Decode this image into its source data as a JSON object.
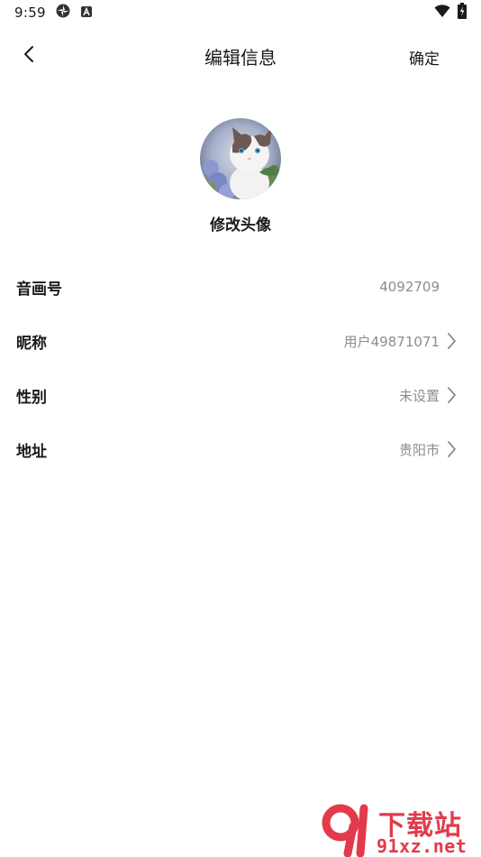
{
  "status_bar": {
    "time": "9:59"
  },
  "header": {
    "title": "编辑信息",
    "confirm_label": "确定"
  },
  "avatar": {
    "change_label": "修改头像"
  },
  "rows": [
    {
      "label": "音画号",
      "value": "4092709",
      "has_arrow": false
    },
    {
      "label": "昵称",
      "value": "用户49871071",
      "has_arrow": true
    },
    {
      "label": "性别",
      "value": "未设置",
      "has_arrow": true
    },
    {
      "label": "地址",
      "value": "贵阳市",
      "has_arrow": true
    }
  ],
  "watermark": {
    "top": "下载站",
    "bottom": "91xz.net"
  },
  "colors": {
    "background": "#ffffff",
    "text_primary": "#1a1a1a",
    "text_secondary": "#8c8c8c",
    "watermark": "#e23a4a"
  }
}
